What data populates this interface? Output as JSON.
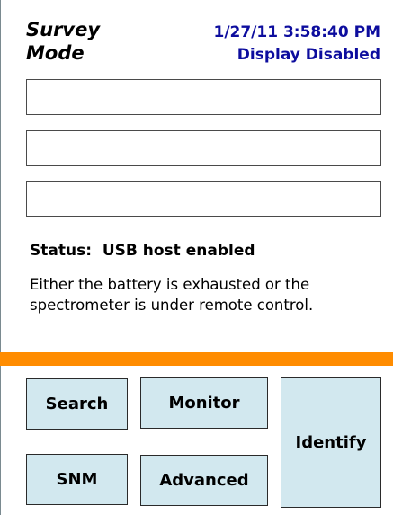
{
  "header": {
    "mode_title": "Survey\nMode",
    "datetime": "1/27/11 3:58:40 PM",
    "display_state": "Display Disabled"
  },
  "status": {
    "label": "Status:",
    "value": "USB host enabled",
    "message": "Either the battery is exhausted or the spectrometer is under remote control."
  },
  "buttons": {
    "search": "Search",
    "monitor": "Monitor",
    "identify": "Identify",
    "snm": "SNM",
    "advanced": "Advanced"
  },
  "colors": {
    "header_text": "#0d0d9e",
    "divider": "#ff8c00",
    "button_bg": "#d2e8ef"
  }
}
